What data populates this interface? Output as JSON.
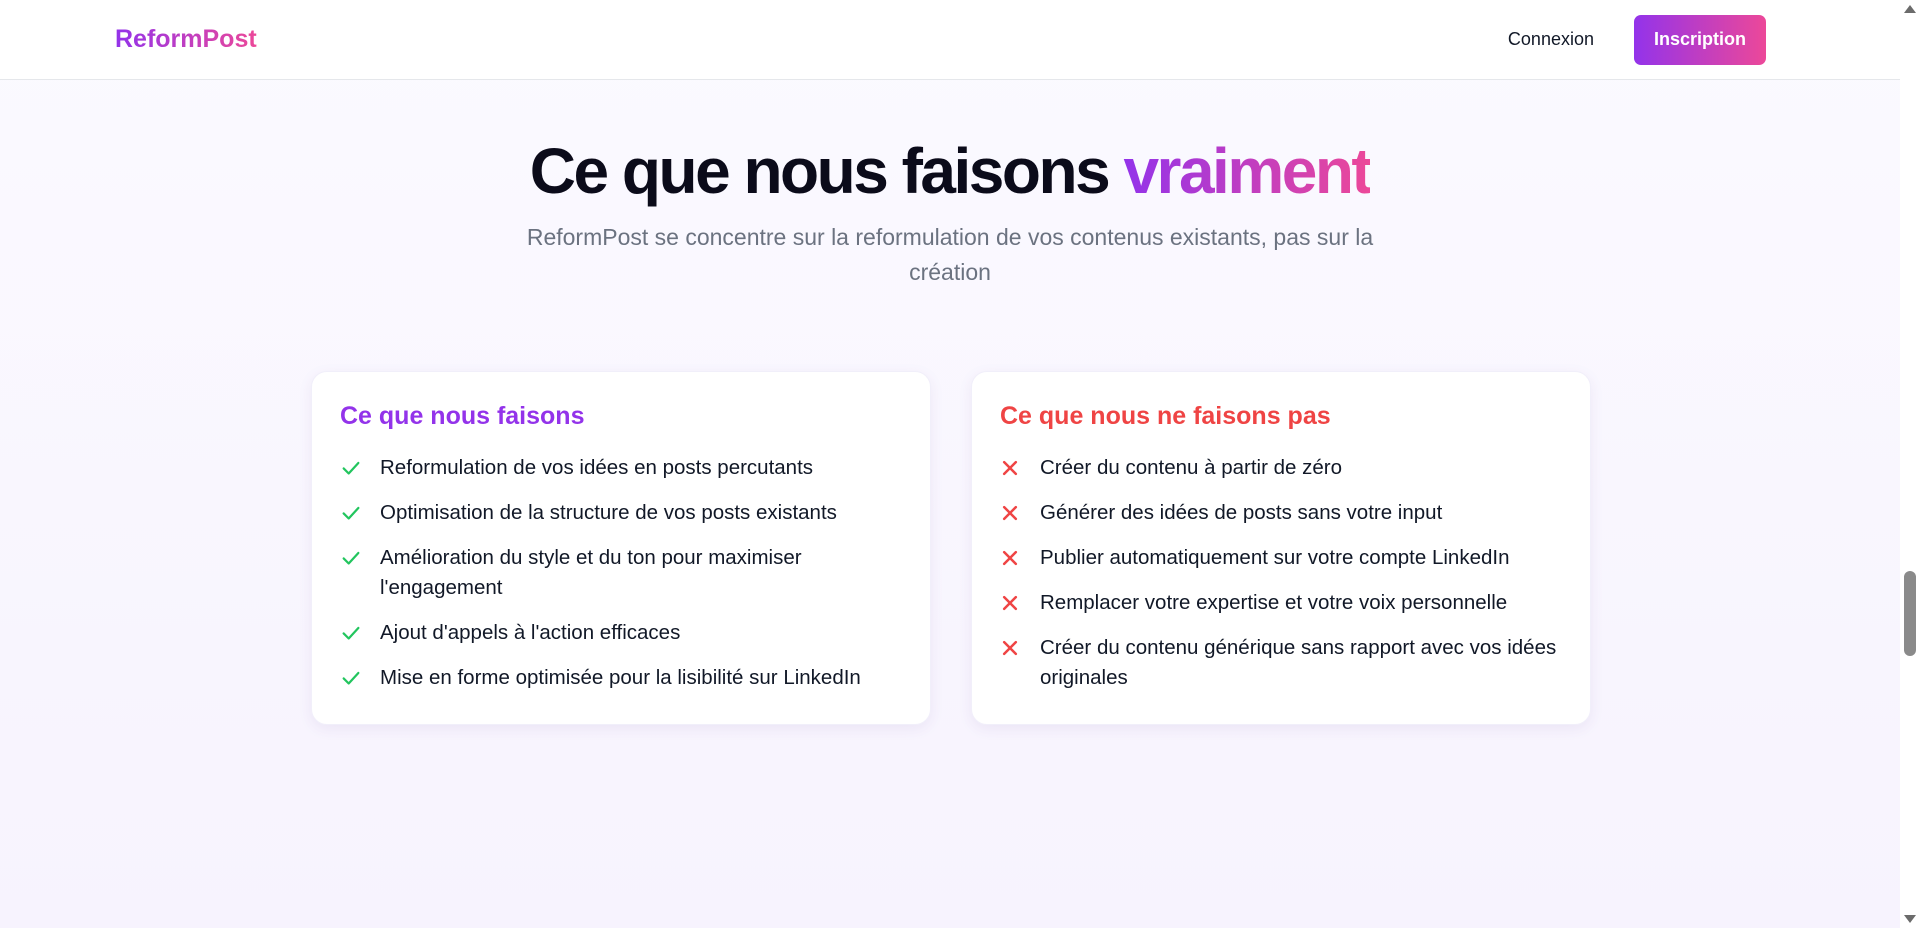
{
  "header": {
    "logo": "ReformPost",
    "login_label": "Connexion",
    "signup_label": "Inscription"
  },
  "hero": {
    "title_main": "Ce que nous faisons ",
    "title_accent": "vraiment",
    "subtitle": "ReformPost se concentre sur la reformulation de vos contenus existants, pas sur la création"
  },
  "cards": {
    "do": {
      "title": "Ce que nous faisons",
      "icon": "check-icon",
      "color": "#22c55e",
      "items": [
        "Reformulation de vos idées en posts percutants",
        "Optimisation de la structure de vos posts existants",
        "Amélioration du style et du ton pour maximiser l'engagement",
        "Ajout d'appels à l'action efficaces",
        "Mise en forme optimisée pour la lisibilité sur LinkedIn"
      ]
    },
    "dont": {
      "title": "Ce que nous ne faisons pas",
      "icon": "x-icon",
      "color": "#ef4444",
      "items": [
        "Créer du contenu à partir de zéro",
        "Générer des idées de posts sans votre input",
        "Publier automatiquement sur votre compte LinkedIn",
        "Remplacer votre expertise et votre voix personnelle",
        "Créer du contenu générique sans rapport avec vos idées originales"
      ]
    }
  },
  "colors": {
    "brand_purple": "#9333ea",
    "brand_pink": "#ec4899",
    "check_green": "#22c55e",
    "cross_red": "#ef4444"
  }
}
